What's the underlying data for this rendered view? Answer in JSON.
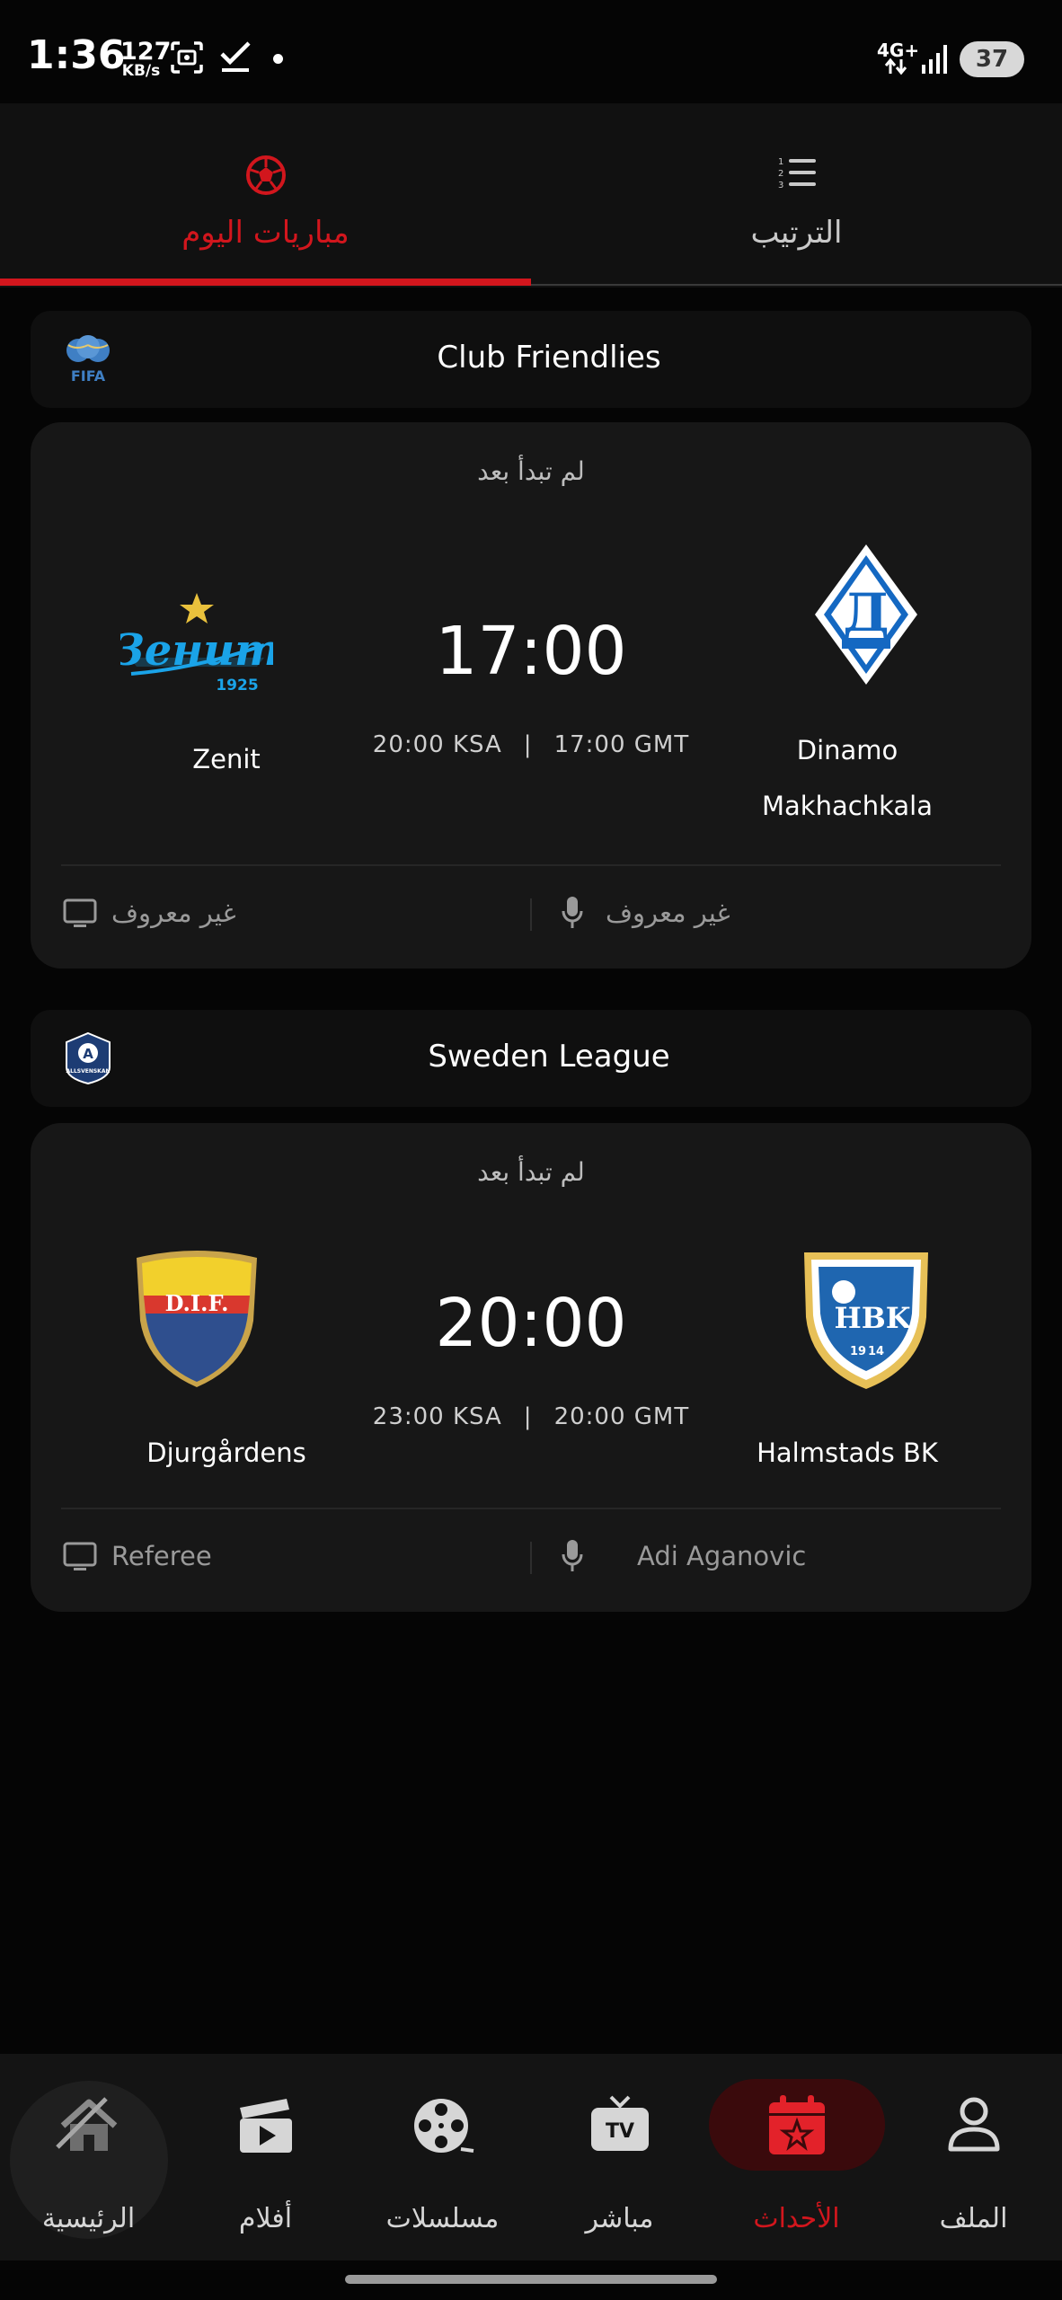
{
  "status_bar": {
    "time": "1:36",
    "net_speed_value": "127",
    "net_speed_unit": "KB/s",
    "network_type": "4G+",
    "battery": "37"
  },
  "tabs": [
    {
      "label": "مباريات اليوم",
      "icon": "soccer-ball-icon",
      "active": true
    },
    {
      "label": "الترتيب",
      "icon": "ranking-list-icon",
      "active": false
    }
  ],
  "leagues": [
    {
      "name": "Club Friendlies",
      "logo": "fifa-logo",
      "match": {
        "state": "لم تبدأ بعد",
        "home_team": "Zenit",
        "away_team_line1": "Dinamo",
        "away_team_line2": "Makhachkala",
        "kickoff": "17:00",
        "time_ksa": "20:00 KSA",
        "time_gmt": "17:00 GMT",
        "separator": "|",
        "channel": "غير معروف",
        "commentator": "غير معروف"
      }
    },
    {
      "name": "Sweden League",
      "logo": "allsvenskan-logo",
      "match": {
        "state": "لم تبدأ بعد",
        "home_team": "Djurgårdens",
        "away_team": "Halmstads BK",
        "kickoff": "20:00",
        "time_ksa": "23:00 KSA",
        "time_gmt": "20:00 GMT",
        "separator": "|",
        "channel": "Referee",
        "commentator": "Adi Aganovic"
      }
    }
  ],
  "crest_text": {
    "zenit": "Зенит",
    "zenit_year": "1925",
    "dinamo_letter": "Д",
    "dif": "D.I.F.",
    "hbk": "HBK",
    "hbk_year_left": "19",
    "hbk_year_right": "14",
    "fifa": "FIFA",
    "allsvenskan": "ALLSVENSKAN"
  },
  "bottom_nav": [
    {
      "label": "الرئيسية",
      "icon": "home-icon"
    },
    {
      "label": "أفلام",
      "icon": "clapperboard-icon"
    },
    {
      "label": "مسلسلات",
      "icon": "film-reel-icon"
    },
    {
      "label": "مباشر",
      "icon": "tv-icon"
    },
    {
      "label": "الأحداث",
      "icon": "calendar-star-icon",
      "active": true
    },
    {
      "label": "الملف",
      "icon": "profile-icon"
    }
  ],
  "colors": {
    "accent": "#d2161d",
    "background": "#050505",
    "card": "#171717"
  }
}
